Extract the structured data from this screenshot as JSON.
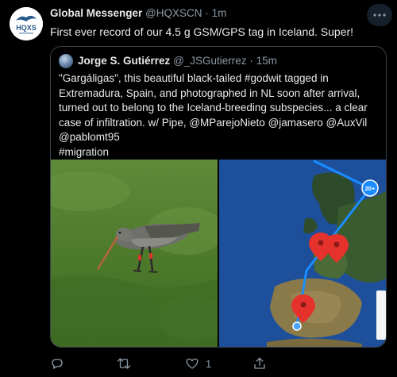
{
  "author": {
    "name": "Global Messenger",
    "handle": "@HQXSCN",
    "separator": "·",
    "time": "1m",
    "logo_text": "HQXS"
  },
  "tweet": {
    "text": "First ever record of our 4.5 g GSM/GPS tag in Iceland. Super!"
  },
  "quoted": {
    "name": "Jorge S. Gutiérrez",
    "handle": "@_JSGutierrez",
    "separator": "·",
    "time": "15m",
    "lines": [
      "\"Gargáligas\", this beautiful black-tailed #godwit tagged in",
      "Extremadura, Spain, and photographed in NL soon after arrival,",
      "turned out to belong to the Iceland-breeding subspecies... a clear",
      "case of infiltration. w/ Pipe, @MParejoNieto @jamasero @AuxVil",
      "@pablomt95",
      "#migration"
    ],
    "map_badge": "20+"
  },
  "actions": {
    "reply_count": "",
    "retweet_count": "",
    "like_count": "1",
    "icons": [
      "reply-icon",
      "retweet-icon",
      "like-icon",
      "share-icon"
    ]
  },
  "colors": {
    "background": "#000000",
    "text": "#e7e9ea",
    "muted": "#8b98a5",
    "border": "#38444d",
    "map_route": "#1a8cff",
    "map_pin": "#e5322d"
  }
}
